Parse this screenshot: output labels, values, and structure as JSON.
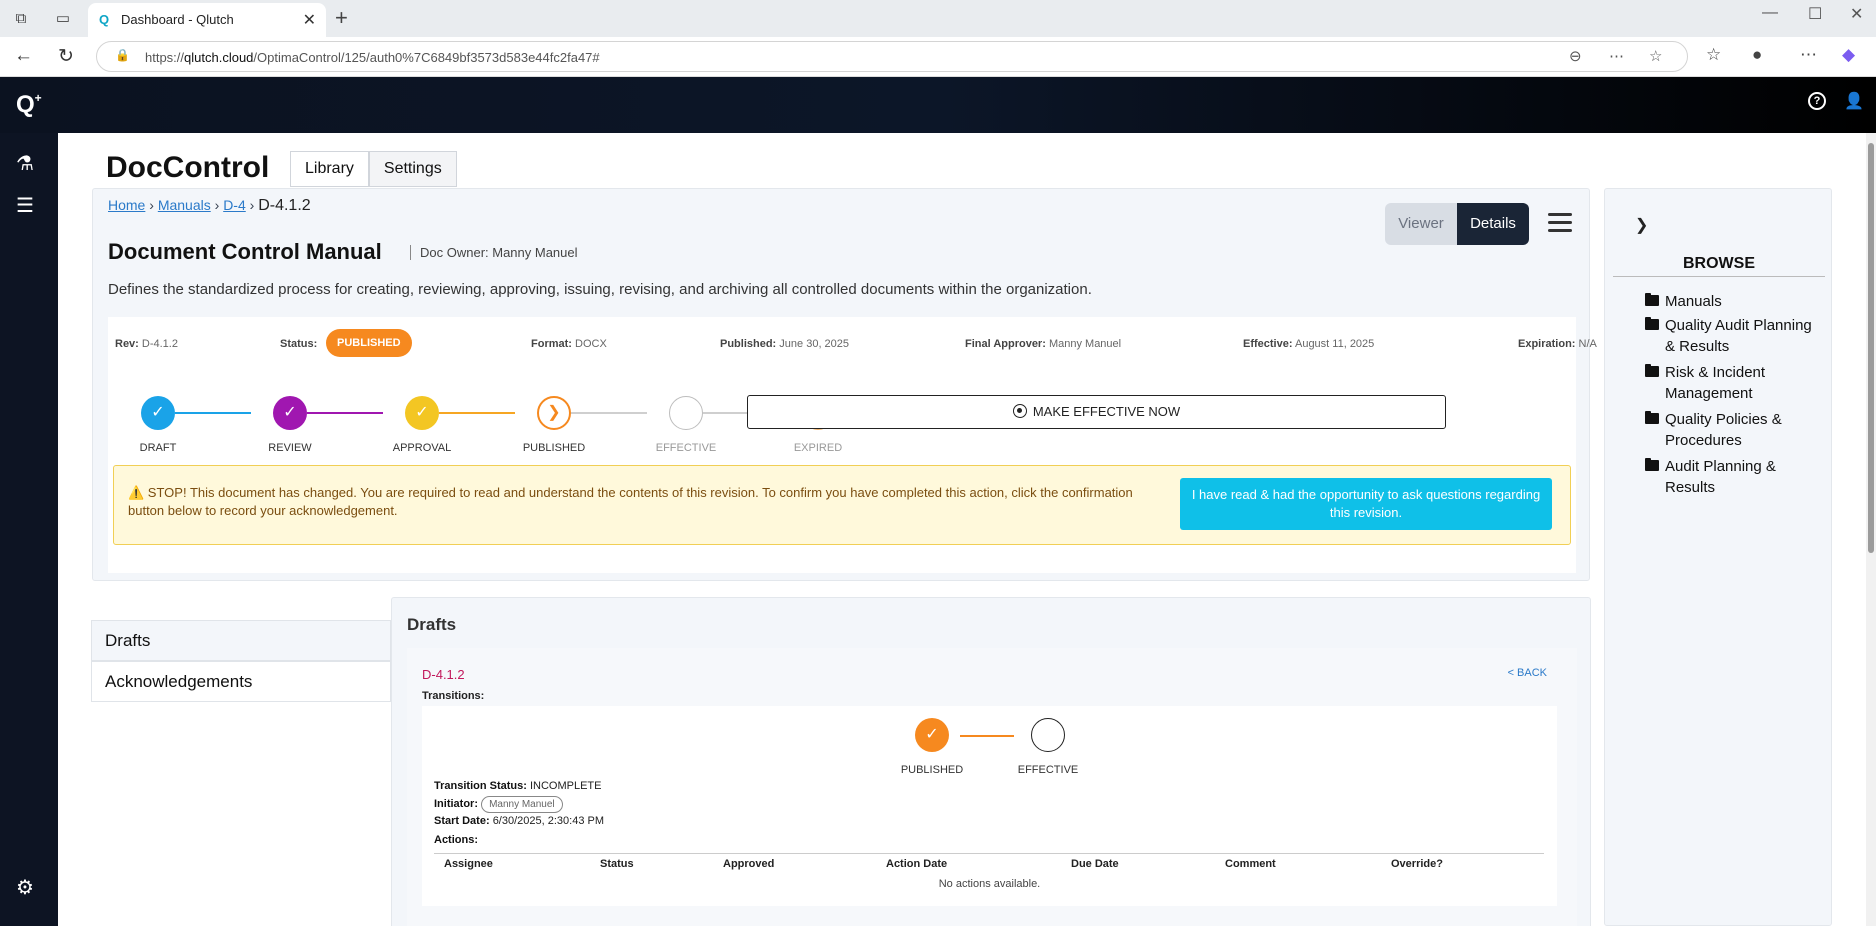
{
  "browser": {
    "tab_title": "Dashboard - Qlutch",
    "url_prefix": "https://",
    "url_host": "qlutch.cloud",
    "url_path": "/OptimaControl/125/auth0%7C6849bf3573d583e44fc2fa47#"
  },
  "app": {
    "title": "DocControl",
    "tabs": [
      "Library",
      "Settings"
    ]
  },
  "breadcrumb": {
    "home": "Home",
    "manuals": "Manuals",
    "d4": "D-4",
    "current": "D-4.1.2"
  },
  "doc": {
    "title": "Document Control Manual",
    "owner": "Doc Owner: Manny Manuel",
    "description": "Defines the standardized process for creating, reviewing, approving, issuing, revising, and archiving all controlled documents within the organization."
  },
  "view_toggle": {
    "viewer": "Viewer",
    "details": "Details"
  },
  "meta": {
    "rev_label": "Rev:",
    "rev": "D-4.1.2",
    "status_label": "Status:",
    "status": "PUBLISHED",
    "format_label": "Format:",
    "format": "DOCX",
    "published_label": "Published:",
    "published": "June 30, 2025",
    "approver_label": "Final Approver:",
    "approver": "Manny Manuel",
    "effective_label": "Effective:",
    "effective": "August 11, 2025",
    "expiration_label": "Expiration:",
    "expiration": "N/A"
  },
  "steps": [
    {
      "label": "DRAFT",
      "state": "done",
      "color": "#1aa3e8"
    },
    {
      "label": "REVIEW",
      "state": "done",
      "color": "#a017b0"
    },
    {
      "label": "APPROVAL",
      "state": "done",
      "color": "#f3c623"
    },
    {
      "label": "PUBLISHED",
      "state": "current",
      "color": "#f6891f"
    },
    {
      "label": "EFFECTIVE",
      "state": "pending",
      "color": "#bdbdbd"
    },
    {
      "label": "EXPIRED",
      "state": "pending",
      "color": "#f1b36b"
    }
  ],
  "make_effective": "MAKE EFFECTIVE NOW",
  "warning": {
    "text": "⚠️ STOP! This document has changed. You are required to read and understand the contents of this revision. To confirm you have completed this action, click the confirmation button below to record your acknowledgement.",
    "button": "I have read & had the opportunity to ask questions regarding this revision."
  },
  "browse": {
    "title": "BROWSE",
    "items": [
      "Manuals",
      "Quality Audit Planning & Results",
      "Risk & Incident Management",
      "Quality Policies & Procedures",
      "Audit Planning & Results"
    ]
  },
  "side_tabs": [
    "Drafts",
    "Acknowledgements"
  ],
  "drafts": {
    "heading": "Drafts",
    "id": "D-4.1.2",
    "back": "< BACK",
    "transitions_label": "Transitions:",
    "t_steps": [
      "PUBLISHED",
      "EFFECTIVE"
    ],
    "status_label": "Transition Status:",
    "status": "INCOMPLETE",
    "initiator_label": "Initiator:",
    "initiator": "Manny Manuel",
    "start_label": "Start Date:",
    "start": "6/30/2025, 2:30:43 PM",
    "actions_label": "Actions:",
    "columns": [
      "Assignee",
      "Status",
      "Approved",
      "Action Date",
      "Due Date",
      "Comment",
      "Override?"
    ],
    "empty": "No actions available."
  }
}
